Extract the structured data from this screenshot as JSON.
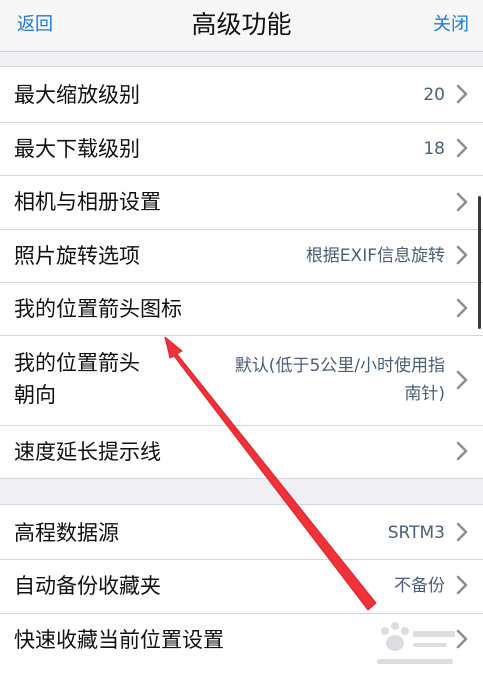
{
  "nav": {
    "back_label": "返回",
    "title": "高级功能",
    "close_label": "关闭"
  },
  "group1": [
    {
      "label": "最大缩放级别",
      "value": "20"
    },
    {
      "label": "最大下载级别",
      "value": "18"
    },
    {
      "label": "相机与相册设置",
      "value": ""
    },
    {
      "label": "照片旋转选项",
      "value": "根据EXIF信息旋转"
    },
    {
      "label": "我的位置箭头图标",
      "value": ""
    },
    {
      "label_line1": "我的位置箭头",
      "label_line2": "朝向",
      "value_line1": "默认(低于5公里/小时使用指",
      "value_line2": "南针)"
    },
    {
      "label": "速度延长提示线",
      "value": ""
    }
  ],
  "group2": [
    {
      "label": "高程数据源",
      "value": "SRTM3"
    },
    {
      "label": "自动备份收藏夹",
      "value": "不备份"
    },
    {
      "label": "快速收藏当前位置设置",
      "value": ""
    }
  ],
  "colors": {
    "accent": "#1f7ad9",
    "annotation_arrow": "#f0323a"
  },
  "icons": {
    "row_chevron": "chevron-right-icon",
    "annotation": "red-arrow-annotation",
    "watermark": "baidu-paw-watermark"
  }
}
